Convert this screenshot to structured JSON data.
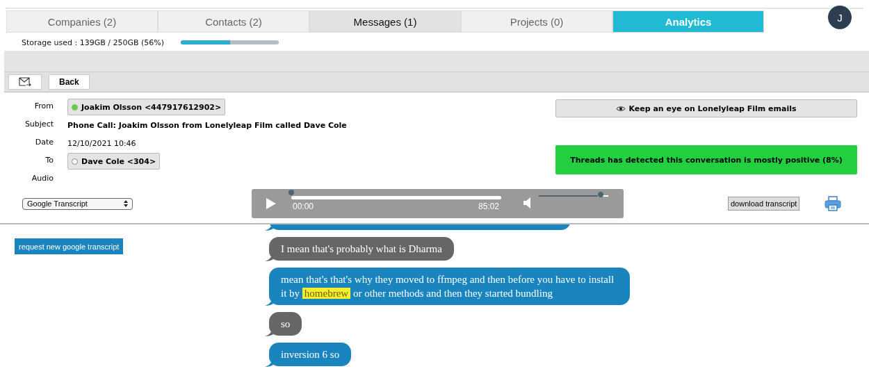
{
  "tabs": [
    {
      "label": "Companies  (2)",
      "selected": false,
      "kind": "plain"
    },
    {
      "label": "Contacts  (2)",
      "selected": false,
      "kind": "plain"
    },
    {
      "label": "Messages (1)",
      "selected": true,
      "kind": "plain"
    },
    {
      "label": "Projects  (0)",
      "selected": false,
      "kind": "plain"
    },
    {
      "label": "Analytics",
      "selected": false,
      "kind": "accent"
    }
  ],
  "avatar": {
    "initial": "J"
  },
  "storage": {
    "label": "Storage used : 139GB / 250GB (56%)",
    "level": 0.5
  },
  "toolbar": {
    "back": "Back"
  },
  "message": {
    "fields": [
      {
        "label": "From",
        "kind": "contact",
        "value": "Joakim Olsson <447917612902>",
        "online": true
      },
      {
        "label": "Subject",
        "kind": "bold",
        "value": "Phone Call: Joakim Olsson from Lonelyleap Film called Dave Cole"
      },
      {
        "label": "Date",
        "kind": "plain",
        "value": "12/10/2021  10:46"
      },
      {
        "label": "To",
        "kind": "contact",
        "value": "Dave Cole <304>",
        "online": false
      },
      {
        "label": "Audio",
        "kind": "empty"
      }
    ],
    "watch_button": "Keep an eye on Lonelyleap Film emails",
    "sentiment": "Threads has detected this conversation is mostly positive (8%)"
  },
  "player": {
    "current": "00:00",
    "duration": "85:02",
    "level": 0
  },
  "transcript_select": {
    "value": "Google Transcript"
  },
  "download_button": "download transcript",
  "request_button": "request new google transcript",
  "transcript": [
    {
      "color": "#1a84bf"
    },
    {
      "color": "#666666",
      "parts": [
        {
          "text": "I mean that's probably what is Dharma",
          "highlighted": false
        }
      ]
    },
    {
      "color": "#1a84bf",
      "parts": [
        {
          "text": "mean that's that's why they moved to ffmpeg and then before you have to install it by ",
          "highlighted": false
        },
        {
          "text": "homebrew",
          "highlighted": true
        },
        {
          "text": " or other methods and then they started bundling",
          "highlighted": false
        }
      ]
    },
    {
      "color": "#666666",
      "parts": [
        {
          "text": "so",
          "highlighted": false
        }
      ]
    },
    {
      "color": "#1a84bf",
      "parts": [
        {
          "text": "inversion 6 so",
          "highlighted": false
        }
      ]
    }
  ]
}
